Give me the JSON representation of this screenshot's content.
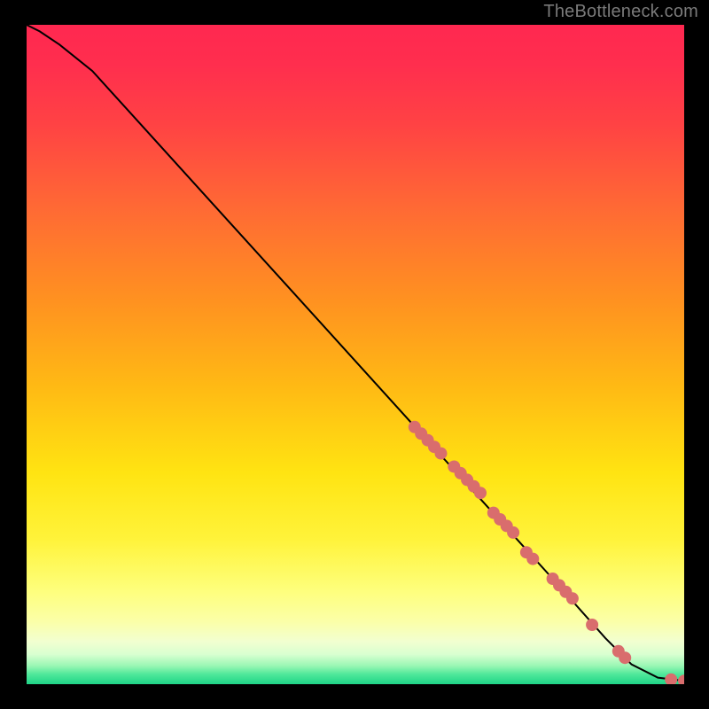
{
  "attribution": "TheBottleneck.com",
  "chart_data": {
    "type": "line",
    "title": "",
    "xlabel": "",
    "ylabel": "",
    "xlim": [
      0,
      100
    ],
    "ylim": [
      0,
      100
    ],
    "grid": false,
    "series": [
      {
        "name": "bottleneck-curve",
        "x": [
          0,
          2,
          5,
          10,
          20,
          30,
          40,
          50,
          60,
          70,
          80,
          88,
          92,
          96,
          100
        ],
        "y": [
          100,
          99,
          97,
          93,
          82,
          71,
          60,
          49,
          38,
          27,
          16,
          7,
          3,
          1,
          0.5
        ],
        "color": "#000000"
      }
    ],
    "highlights": {
      "name": "highlighted-points",
      "color": "#d96d6d",
      "points": [
        {
          "x": 59,
          "y": 39
        },
        {
          "x": 60,
          "y": 38
        },
        {
          "x": 61,
          "y": 37
        },
        {
          "x": 62,
          "y": 36
        },
        {
          "x": 63,
          "y": 35
        },
        {
          "x": 65,
          "y": 33
        },
        {
          "x": 66,
          "y": 32
        },
        {
          "x": 67,
          "y": 31
        },
        {
          "x": 68,
          "y": 30
        },
        {
          "x": 69,
          "y": 29
        },
        {
          "x": 71,
          "y": 26
        },
        {
          "x": 72,
          "y": 25
        },
        {
          "x": 73,
          "y": 24
        },
        {
          "x": 74,
          "y": 23
        },
        {
          "x": 76,
          "y": 20
        },
        {
          "x": 77,
          "y": 19
        },
        {
          "x": 80,
          "y": 16
        },
        {
          "x": 81,
          "y": 15
        },
        {
          "x": 82,
          "y": 14
        },
        {
          "x": 83,
          "y": 13
        },
        {
          "x": 86,
          "y": 9
        },
        {
          "x": 90,
          "y": 5
        },
        {
          "x": 91,
          "y": 4
        },
        {
          "x": 98,
          "y": 0.7
        },
        {
          "x": 100,
          "y": 0.5
        }
      ]
    },
    "gradient_stops": [
      {
        "offset": 0.0,
        "color": "#ff2850"
      },
      {
        "offset": 0.06,
        "color": "#ff2e4e"
      },
      {
        "offset": 0.15,
        "color": "#ff4244"
      },
      {
        "offset": 0.28,
        "color": "#ff6a34"
      },
      {
        "offset": 0.42,
        "color": "#ff9220"
      },
      {
        "offset": 0.55,
        "color": "#ffba14"
      },
      {
        "offset": 0.68,
        "color": "#ffe412"
      },
      {
        "offset": 0.78,
        "color": "#fff33a"
      },
      {
        "offset": 0.86,
        "color": "#feff7e"
      },
      {
        "offset": 0.905,
        "color": "#fbffa8"
      },
      {
        "offset": 0.935,
        "color": "#f2ffd0"
      },
      {
        "offset": 0.955,
        "color": "#d8ffd0"
      },
      {
        "offset": 0.972,
        "color": "#9af7b4"
      },
      {
        "offset": 0.985,
        "color": "#4fe89a"
      },
      {
        "offset": 1.0,
        "color": "#1fd487"
      }
    ]
  }
}
